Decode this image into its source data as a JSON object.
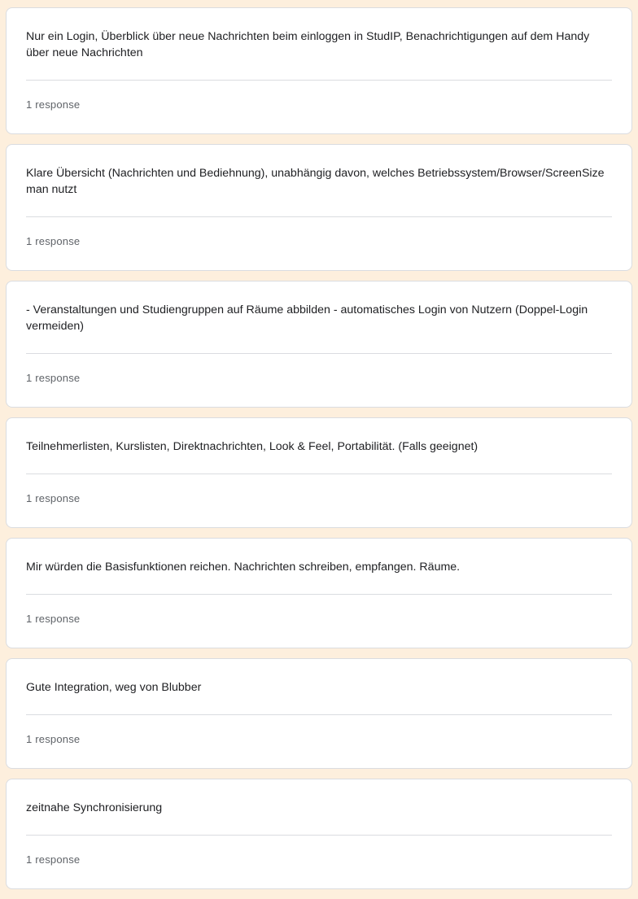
{
  "responses": [
    {
      "text": "Nur ein Login, Überblick über neue Nachrichten beim einloggen in StudIP, Benachrichtigungen auf dem Handy über neue Nachrichten",
      "count": "1 response"
    },
    {
      "text": "Klare Übersicht (Nachrichten und Bediehnung), unabhängig davon, welches Betriebssystem/Browser/ScreenSize man nutzt",
      "count": "1 response"
    },
    {
      "text": "- Veranstaltungen und Studiengruppen auf Räume abbilden - automatisches Login von Nutzern (Doppel-Login vermeiden)",
      "count": "1 response"
    },
    {
      "text": "Teilnehmerlisten, Kurslisten, Direktnachrichten, Look & Feel, Portabilität. (Falls geeignet)",
      "count": "1 response"
    },
    {
      "text": "Mir würden die Basisfunktionen reichen. Nachrichten schreiben, empfangen. Räume.",
      "count": "1 response"
    },
    {
      "text": "Gute Integration, weg von Blubber",
      "count": "1 response"
    },
    {
      "text": "zeitnahe Synchronisierung",
      "count": "1 response"
    }
  ]
}
